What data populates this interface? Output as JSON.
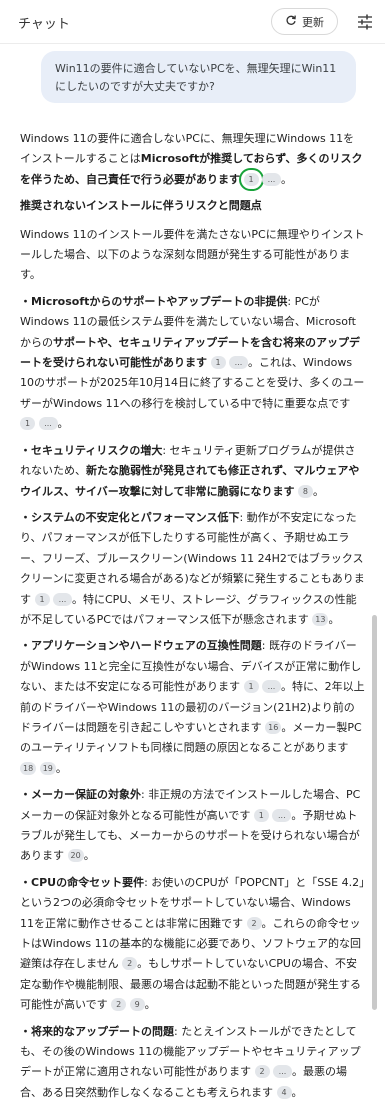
{
  "header": {
    "title": "チャット",
    "refresh_label": "更新",
    "refresh_icon": "refresh-icon",
    "settings_icon": "settings-sliders-icon"
  },
  "user_message": "Win11の要件に適合していないPCを、無理矢理にWin11にしたいのですが大丈夫ですか?",
  "answer": {
    "intro_a": "Windows 11の要件に適合しないPCに、無理矢理にWindows 11をインストールすることは",
    "intro_b": "Microsoftが推奨しておらず、多くのリスクを伴うため、自己責任で行う必要があります",
    "intro_cite": "1",
    "more": "...",
    "heading": "推奨されないインストールに伴うリスクと問題点",
    "lead": "Windows 11のインストール要件を満たさないPCに無理やりインストールした場合、以下のような深刻な問題が発生する可能性があります。",
    "items": [
      {
        "title": "・Microsoftからのサポートやアップデートの非提供",
        "t1": ": PCがWindows 11の最低システム要件を満たしていない場合、Microsoftからの",
        "b1": "サポートや、セキュリティアップデートを含む将来のアップデートを受けられない可能性があります",
        "c1": "1",
        "t2": "。これは、Windows 10のサポートが2025年10月14日に終了することを受け、多くのユーザーがWindows 11への移行を検討している中で特に重要な点です",
        "c2": "1"
      },
      {
        "title": "・セキュリティリスクの増大",
        "t1": ": セキュリティ更新プログラムが提供されないため、",
        "b1": "新たな脆弱性が発見されても修正されず、マルウェアやウイルス、サイバー攻撃に対して非常に脆弱になります",
        "c1": "8"
      },
      {
        "title": "・システムの不安定化とパフォーマンス低下",
        "t1": ": 動作が不安定になったり、パフォーマンスが低下したりする可能性が高く、予期せぬエラー、フリーズ、ブルースクリーン(Windows 11 24H2ではブラックスクリーンに変更される場合がある)などが頻繁に発生することもあります",
        "c1": "1",
        "t2": "。特にCPU、メモリ、ストレージ、グラフィックスの性能が不足しているPCではパフォーマンス低下が懸念されます",
        "c2": "13"
      },
      {
        "title": "・アプリケーションやハードウェアの互換性問題",
        "t1": ": 既存のドライバーがWindows 11と完全に互換性がない場合、デバイスが正常に動作しない、または不安定になる可能性があります",
        "c1": "1",
        "t2": "。特に、2年以上前のドライバーやWindows 11の最初のバージョン(21H2)より前のドライバーは問題を引き起こしやすいとされます",
        "c2": "16",
        "t3": "。メーカー製PCのユーティリティソフトも同様に問題の原因となることがあります",
        "c3": "18",
        "c4": "19"
      },
      {
        "title": "・メーカー保証の対象外",
        "t1": ": 非正規の方法でインストールした場合、PCメーカーの保証対象外となる可能性が高いです",
        "c1": "1",
        "t2": "。予期せぬトラブルが発生しても、メーカーからのサポートを受けられない場合があります",
        "c2": "20"
      },
      {
        "title": "・CPUの命令セット要件",
        "t1": ": お使いのCPUが「POPCNT」と「SSE 4.2」という2つの必須命令セットをサポートしていない場合、Windows 11を正常に動作させることは非常に困難です",
        "c1": "2",
        "t2": "。これらの命令セットはWindows 11の基本的な機能に必要であり、ソフトウェア的な回避策は存在しません",
        "c2": "2",
        "t3": "。もしサポートしていないCPUの場合、不安定な動作や機能制限、最悪の場合は起動不能といった問題が発生する可能性が高いです",
        "c3": "2",
        "c4": "9"
      },
      {
        "title": "・将来的なアップデートの問題",
        "t1": ": たとえインストールができたとしても、その後のWindows 11の機能アップデートやセキュリティアップデートが正常に適用されない可能性があります",
        "c1": "2",
        "t2": "。最悪の場合、ある日突然動作しなくなることも考えられます",
        "c2": "4"
      }
    ]
  }
}
